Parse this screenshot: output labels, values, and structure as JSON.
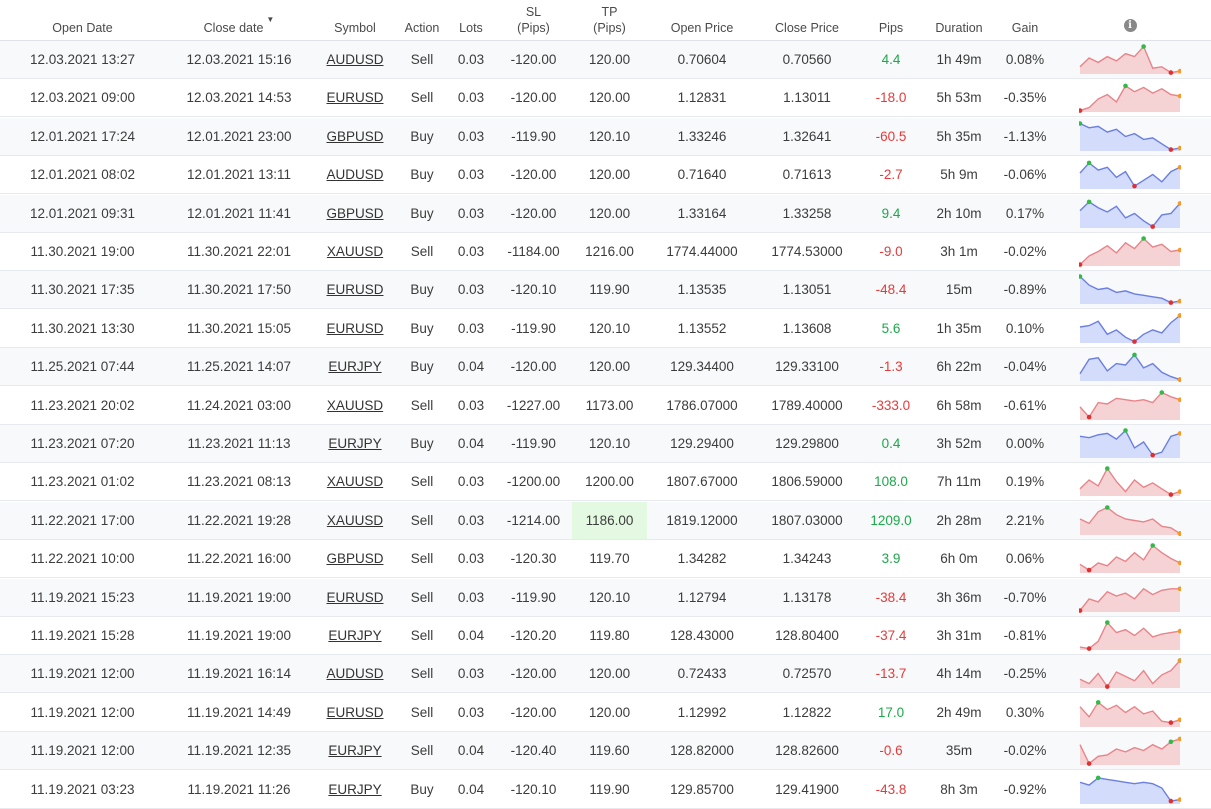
{
  "headers": {
    "open_date": "Open Date",
    "close_date": "Close date",
    "symbol": "Symbol",
    "action": "Action",
    "lots": "Lots",
    "sl": "SL\n(Pips)",
    "tp": "TP\n(Pips)",
    "open_price": "Open Price",
    "close_price": "Close Price",
    "pips": "Pips",
    "duration": "Duration",
    "gain": "Gain",
    "info_icon": "info-icon",
    "sort_icon": "sort-desc-icon"
  },
  "colors": {
    "positive": "#1da84a",
    "negative": "#e63a3a",
    "spark_red_line": "#e8848a",
    "spark_red_fill": "#f5d3d5",
    "spark_blue_line": "#6b7fe3",
    "spark_blue_fill": "#d3dcfb",
    "highlight": "#e3f9e1",
    "high_dot": "#33b94a",
    "low_dot": "#e03030",
    "end_dot": "#f59a2a"
  },
  "trades": [
    {
      "open_date": "12.03.2021 13:27",
      "close_date": "12.03.2021 15:16",
      "symbol": "AUDUSD",
      "action": "Sell",
      "lots": "0.03",
      "sl": "-120.00",
      "tp": "120.00",
      "open_price": "0.70604",
      "close_price": "0.70560",
      "pips": "4.4",
      "duration": "1h 49m",
      "gain": "0.08%",
      "spark": {
        "trend": "red",
        "points": [
          0.25,
          0.55,
          0.4,
          0.6,
          0.45,
          0.7,
          0.6,
          0.95,
          0.2,
          0.25,
          0.05,
          0.1
        ],
        "high": 7,
        "low": 10
      }
    },
    {
      "open_date": "12.03.2021 09:00",
      "close_date": "12.03.2021 14:53",
      "symbol": "EURUSD",
      "action": "Sell",
      "lots": "0.03",
      "sl": "-120.00",
      "tp": "120.00",
      "open_price": "1.12831",
      "close_price": "1.13011",
      "pips": "-18.0",
      "duration": "5h 53m",
      "gain": "-0.35%",
      "spark": {
        "trend": "red",
        "points": [
          0.05,
          0.15,
          0.45,
          0.6,
          0.35,
          0.9,
          0.7,
          0.85,
          0.65,
          0.8,
          0.6,
          0.55
        ],
        "high": 5,
        "low": 0
      }
    },
    {
      "open_date": "12.01.2021 17:24",
      "close_date": "12.01.2021 23:00",
      "symbol": "GBPUSD",
      "action": "Buy",
      "lots": "0.03",
      "sl": "-119.90",
      "tp": "120.10",
      "open_price": "1.33246",
      "close_price": "1.32641",
      "pips": "-60.5",
      "duration": "5h 35m",
      "gain": "-1.13%",
      "spark": {
        "trend": "blue",
        "points": [
          0.95,
          0.8,
          0.85,
          0.65,
          0.75,
          0.5,
          0.6,
          0.4,
          0.45,
          0.25,
          0.05,
          0.1
        ],
        "high": 0,
        "low": 10
      }
    },
    {
      "open_date": "12.01.2021 08:02",
      "close_date": "12.01.2021 13:11",
      "symbol": "AUDUSD",
      "action": "Buy",
      "lots": "0.03",
      "sl": "-120.00",
      "tp": "120.00",
      "open_price": "0.71640",
      "close_price": "0.71613",
      "pips": "-2.7",
      "duration": "5h 9m",
      "gain": "-0.06%",
      "spark": {
        "trend": "blue",
        "points": [
          0.55,
          0.9,
          0.65,
          0.75,
          0.4,
          0.6,
          0.1,
          0.3,
          0.5,
          0.25,
          0.6,
          0.75
        ],
        "high": 1,
        "low": 6
      }
    },
    {
      "open_date": "12.01.2021 09:31",
      "close_date": "12.01.2021 11:41",
      "symbol": "GBPUSD",
      "action": "Buy",
      "lots": "0.03",
      "sl": "-120.00",
      "tp": "120.00",
      "open_price": "1.33164",
      "close_price": "1.33258",
      "pips": "9.4",
      "duration": "2h 10m",
      "gain": "0.17%",
      "spark": {
        "trend": "blue",
        "points": [
          0.6,
          0.9,
          0.7,
          0.55,
          0.75,
          0.35,
          0.5,
          0.25,
          0.05,
          0.45,
          0.5,
          0.85
        ],
        "high": 1,
        "low": 8
      }
    },
    {
      "open_date": "11.30.2021 19:00",
      "close_date": "11.30.2021 22:01",
      "symbol": "XAUUSD",
      "action": "Sell",
      "lots": "0.03",
      "sl": "-1184.00",
      "tp": "1216.00",
      "open_price": "1774.44000",
      "close_price": "1774.53000",
      "pips": "-9.0",
      "duration": "3h 1m",
      "gain": "-0.02%",
      "spark": {
        "trend": "red",
        "points": [
          0.05,
          0.35,
          0.5,
          0.7,
          0.45,
          0.8,
          0.6,
          0.95,
          0.65,
          0.75,
          0.5,
          0.55
        ],
        "high": 7,
        "low": 0
      }
    },
    {
      "open_date": "11.30.2021 17:35",
      "close_date": "11.30.2021 17:50",
      "symbol": "EURUSD",
      "action": "Buy",
      "lots": "0.03",
      "sl": "-120.10",
      "tp": "119.90",
      "open_price": "1.13535",
      "close_price": "1.13051",
      "pips": "-48.4",
      "duration": "15m",
      "gain": "-0.89%",
      "spark": {
        "trend": "blue",
        "points": [
          0.95,
          0.65,
          0.5,
          0.55,
          0.4,
          0.45,
          0.35,
          0.3,
          0.25,
          0.2,
          0.05,
          0.1
        ],
        "high": 0,
        "low": 10
      }
    },
    {
      "open_date": "11.30.2021 13:30",
      "close_date": "11.30.2021 15:05",
      "symbol": "EURUSD",
      "action": "Buy",
      "lots": "0.03",
      "sl": "-119.90",
      "tp": "120.10",
      "open_price": "1.13552",
      "close_price": "1.13608",
      "pips": "5.6",
      "duration": "1h 35m",
      "gain": "0.10%",
      "spark": {
        "trend": "blue",
        "points": [
          0.55,
          0.6,
          0.75,
          0.3,
          0.45,
          0.2,
          0.05,
          0.3,
          0.45,
          0.35,
          0.7,
          0.95
        ],
        "high": 11,
        "low": 6
      }
    },
    {
      "open_date": "11.25.2021 07:44",
      "close_date": "11.25.2021 14:07",
      "symbol": "EURJPY",
      "action": "Buy",
      "lots": "0.04",
      "sl": "-120.00",
      "tp": "120.00",
      "open_price": "129.34400",
      "close_price": "129.33100",
      "pips": "-1.3",
      "duration": "6h 22m",
      "gain": "-0.04%",
      "spark": {
        "trend": "blue",
        "points": [
          0.25,
          0.75,
          0.8,
          0.35,
          0.6,
          0.55,
          0.9,
          0.45,
          0.6,
          0.3,
          0.15,
          0.05
        ],
        "high": 6,
        "low": 11
      }
    },
    {
      "open_date": "11.23.2021 20:02",
      "close_date": "11.24.2021 03:00",
      "symbol": "XAUUSD",
      "action": "Sell",
      "lots": "0.03",
      "sl": "-1227.00",
      "tp": "1173.00",
      "open_price": "1786.07000",
      "close_price": "1789.40000",
      "pips": "-333.0",
      "duration": "6h 58m",
      "gain": "-0.61%",
      "spark": {
        "trend": "red",
        "points": [
          0.45,
          0.1,
          0.6,
          0.55,
          0.75,
          0.7,
          0.65,
          0.7,
          0.6,
          0.95,
          0.8,
          0.7
        ],
        "high": 9,
        "low": 1
      }
    },
    {
      "open_date": "11.23.2021 07:20",
      "close_date": "11.23.2021 11:13",
      "symbol": "EURJPY",
      "action": "Buy",
      "lots": "0.04",
      "sl": "-119.90",
      "tp": "120.10",
      "open_price": "129.29400",
      "close_price": "129.29800",
      "pips": "0.4",
      "duration": "3h 52m",
      "gain": "0.00%",
      "spark": {
        "trend": "blue",
        "points": [
          0.75,
          0.7,
          0.8,
          0.85,
          0.65,
          0.95,
          0.35,
          0.55,
          0.1,
          0.2,
          0.75,
          0.85
        ],
        "high": 5,
        "low": 8
      }
    },
    {
      "open_date": "11.23.2021 01:02",
      "close_date": "11.23.2021 08:13",
      "symbol": "XAUUSD",
      "action": "Sell",
      "lots": "0.03",
      "sl": "-1200.00",
      "tp": "1200.00",
      "open_price": "1807.67000",
      "close_price": "1806.59000",
      "pips": "108.0",
      "duration": "7h 11m",
      "gain": "0.19%",
      "spark": {
        "trend": "red",
        "points": [
          0.25,
          0.55,
          0.35,
          0.95,
          0.5,
          0.15,
          0.55,
          0.3,
          0.45,
          0.25,
          0.05,
          0.15
        ],
        "high": 3,
        "low": 10
      }
    },
    {
      "open_date": "11.22.2021 17:00",
      "close_date": "11.22.2021 19:28",
      "symbol": "XAUUSD",
      "action": "Sell",
      "lots": "0.03",
      "sl": "-1214.00",
      "tp": "1186.00",
      "open_price": "1819.12000",
      "close_price": "1807.03000",
      "pips": "1209.0",
      "duration": "2h 28m",
      "gain": "2.21%",
      "tp_highlight": true,
      "spark": {
        "trend": "red",
        "points": [
          0.55,
          0.4,
          0.8,
          0.95,
          0.7,
          0.55,
          0.5,
          0.45,
          0.55,
          0.3,
          0.25,
          0.05
        ],
        "high": 3,
        "low": 11
      }
    },
    {
      "open_date": "11.22.2021 10:00",
      "close_date": "11.22.2021 16:00",
      "symbol": "GBPUSD",
      "action": "Sell",
      "lots": "0.03",
      "sl": "-120.30",
      "tp": "119.70",
      "open_price": "1.34282",
      "close_price": "1.34243",
      "pips": "3.9",
      "duration": "6h 0m",
      "gain": "0.06%",
      "spark": {
        "trend": "red",
        "points": [
          0.3,
          0.1,
          0.35,
          0.25,
          0.55,
          0.4,
          0.7,
          0.45,
          0.95,
          0.7,
          0.5,
          0.35
        ],
        "high": 8,
        "low": 1
      }
    },
    {
      "open_date": "11.19.2021 15:23",
      "close_date": "11.19.2021 19:00",
      "symbol": "EURUSD",
      "action": "Sell",
      "lots": "0.03",
      "sl": "-119.90",
      "tp": "120.10",
      "open_price": "1.12794",
      "close_price": "1.13178",
      "pips": "-38.4",
      "duration": "3h 36m",
      "gain": "-0.70%",
      "spark": {
        "trend": "red",
        "points": [
          0.05,
          0.45,
          0.35,
          0.7,
          0.55,
          0.65,
          0.45,
          0.8,
          0.6,
          0.75,
          0.8,
          0.8
        ],
        "high": 11,
        "low": 0
      }
    },
    {
      "open_date": "11.19.2021 15:28",
      "close_date": "11.19.2021 19:00",
      "symbol": "EURJPY",
      "action": "Sell",
      "lots": "0.04",
      "sl": "-120.20",
      "tp": "119.80",
      "open_price": "128.43000",
      "close_price": "128.80400",
      "pips": "-37.4",
      "duration": "3h 31m",
      "gain": "-0.81%",
      "spark": {
        "trend": "red",
        "points": [
          0.1,
          0.05,
          0.3,
          0.95,
          0.6,
          0.7,
          0.5,
          0.75,
          0.45,
          0.55,
          0.6,
          0.65
        ],
        "high": 3,
        "low": 1
      }
    },
    {
      "open_date": "11.19.2021 12:00",
      "close_date": "11.19.2021 16:14",
      "symbol": "AUDUSD",
      "action": "Sell",
      "lots": "0.03",
      "sl": "-120.00",
      "tp": "120.00",
      "open_price": "0.72433",
      "close_price": "0.72570",
      "pips": "-13.7",
      "duration": "4h 14m",
      "gain": "-0.25%",
      "spark": {
        "trend": "red",
        "points": [
          0.3,
          0.15,
          0.5,
          0.05,
          0.55,
          0.4,
          0.25,
          0.6,
          0.15,
          0.45,
          0.6,
          0.95
        ],
        "high": 11,
        "low": 3
      }
    },
    {
      "open_date": "11.19.2021 12:00",
      "close_date": "11.19.2021 14:49",
      "symbol": "EURUSD",
      "action": "Sell",
      "lots": "0.03",
      "sl": "-120.00",
      "tp": "120.00",
      "open_price": "1.12992",
      "close_price": "1.12822",
      "pips": "17.0",
      "duration": "2h 49m",
      "gain": "0.30%",
      "spark": {
        "trend": "red",
        "points": [
          0.7,
          0.35,
          0.85,
          0.6,
          0.75,
          0.5,
          0.7,
          0.45,
          0.55,
          0.2,
          0.15,
          0.25
        ],
        "high": 2,
        "low": 10
      }
    },
    {
      "open_date": "11.19.2021 12:00",
      "close_date": "11.19.2021 12:35",
      "symbol": "EURJPY",
      "action": "Sell",
      "lots": "0.04",
      "sl": "-120.40",
      "tp": "119.60",
      "open_price": "128.82000",
      "close_price": "128.82600",
      "pips": "-0.6",
      "duration": "35m",
      "gain": "-0.02%",
      "spark": {
        "trend": "red",
        "points": [
          0.7,
          0.05,
          0.3,
          0.35,
          0.55,
          0.45,
          0.6,
          0.5,
          0.7,
          0.55,
          0.8,
          0.9
        ],
        "high": 10,
        "low": 1
      }
    },
    {
      "open_date": "11.19.2021 03:23",
      "close_date": "11.19.2021 11:26",
      "symbol": "EURJPY",
      "action": "Buy",
      "lots": "0.04",
      "sl": "-120.10",
      "tp": "119.90",
      "open_price": "129.85700",
      "close_price": "129.41900",
      "pips": "-43.8",
      "duration": "8h 3m",
      "gain": "-0.92%",
      "spark": {
        "trend": "blue",
        "points": [
          0.75,
          0.65,
          0.9,
          0.85,
          0.8,
          0.75,
          0.7,
          0.75,
          0.7,
          0.55,
          0.1,
          0.15
        ],
        "high": 2,
        "low": 10
      }
    }
  ]
}
